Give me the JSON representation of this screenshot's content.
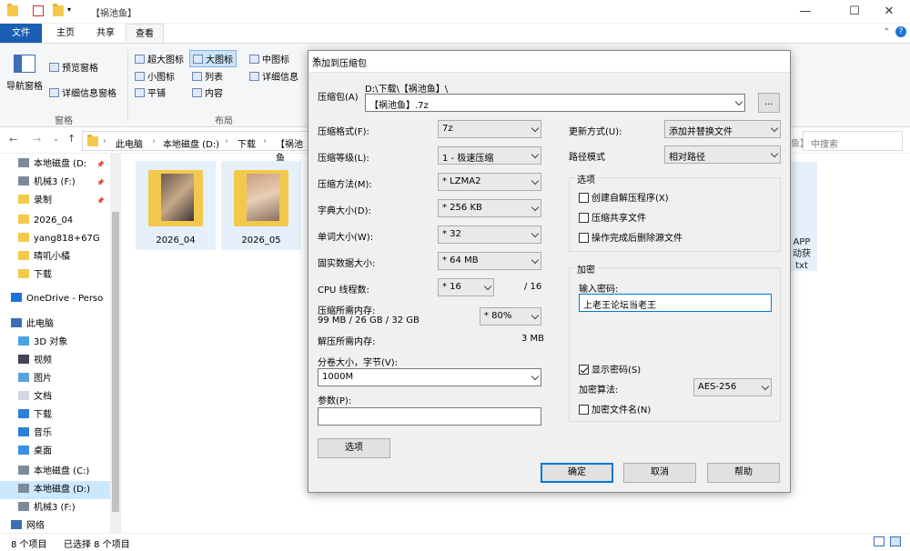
{
  "explorer": {
    "title": "【祸池鱼】",
    "ribbon_tabs": [
      "文件",
      "主页",
      "共享",
      "查看"
    ],
    "ribbon": {
      "nav_pane": "导航窗格",
      "preview_pane": "预览窗格",
      "details_pane": "详细信息窗格",
      "group_panes": "窗格",
      "extra_large_icons": "超大图标",
      "large_icons": "大图标",
      "medium_icons": "中图标",
      "small_icons": "小图标",
      "list": "列表",
      "details": "详细信息",
      "tiles": "平铺",
      "content": "内容",
      "group_layout": "布局"
    },
    "breadcrumbs": [
      "此电脑",
      "本地磁盘 (D:)",
      "下载",
      "【祸池鱼"
    ],
    "search_placeholder": "中搜索",
    "search_prefix": "鱼】",
    "nav_items": [
      "本地磁盘 (D:",
      "机械3 (F:)",
      "录制",
      "2026_04",
      "yang818+67G",
      "晴叽小橘",
      "下载",
      "OneDrive - Perso",
      "此电脑",
      "3D 对象",
      "视频",
      "图片",
      "文档",
      "下载",
      "音乐",
      "桌面",
      "本地磁盘 (C:)",
      "本地磁盘 (D:)",
      "机械3 (F:)",
      "网络"
    ],
    "files": [
      {
        "name": "2026_04"
      },
      {
        "name": "2026_05"
      }
    ],
    "bg_file_label": "APP\n动获\ntxt",
    "status_count": "8 个项目",
    "status_selected": "已选择 8 个项目"
  },
  "dialog": {
    "title": "添加到压缩包",
    "archive_label": "压缩包(A)",
    "archive_path": "D:\\下载\\【祸池鱼】\\",
    "archive_name": "【祸池鱼】.7z",
    "browse_label": "...",
    "format_label": "压缩格式(F):",
    "format_value": "7z",
    "level_label": "压缩等级(L):",
    "level_value": "1 - 极速压缩",
    "method_label": "压缩方法(M):",
    "method_value": "* LZMA2",
    "dict_label": "字典大小(D):",
    "dict_value": "* 256 KB",
    "word_label": "单词大小(W):",
    "word_value": "* 32",
    "solid_label": "固实数据大小:",
    "solid_value": "* 64 MB",
    "cpu_label": "CPU 线程数:",
    "cpu_value": "* 16",
    "cpu_max": "/ 16",
    "mem_comp_label": "压缩所需内存:",
    "mem_comp_value": "99 MB / 26 GB / 32 GB",
    "mem_percent": "* 80%",
    "mem_decomp_label": "解压所需内存:",
    "mem_decomp_value": "3 MB",
    "volume_label": "分卷大小，字节(V):",
    "volume_value": "1000M",
    "params_label": "参数(P):",
    "params_value": "",
    "options_button": "选项",
    "update_label": "更新方式(U):",
    "update_value": "添加并替换文件",
    "pathmode_label": "路径模式",
    "pathmode_value": "相对路径",
    "options_group": "选项",
    "opt_sfx": "创建自解压程序(X)",
    "opt_shared": "压缩共享文件",
    "opt_delete": "操作完成后删除源文件",
    "enc_group": "加密",
    "password_label": "输入密码:",
    "password_value": "上老王论坛当老王",
    "show_password": "显示密码(S)",
    "enc_method_label": "加密算法:",
    "enc_method_value": "AES-256",
    "enc_names": "加密文件名(N)",
    "ok": "确定",
    "cancel": "取消",
    "help": "帮助"
  }
}
